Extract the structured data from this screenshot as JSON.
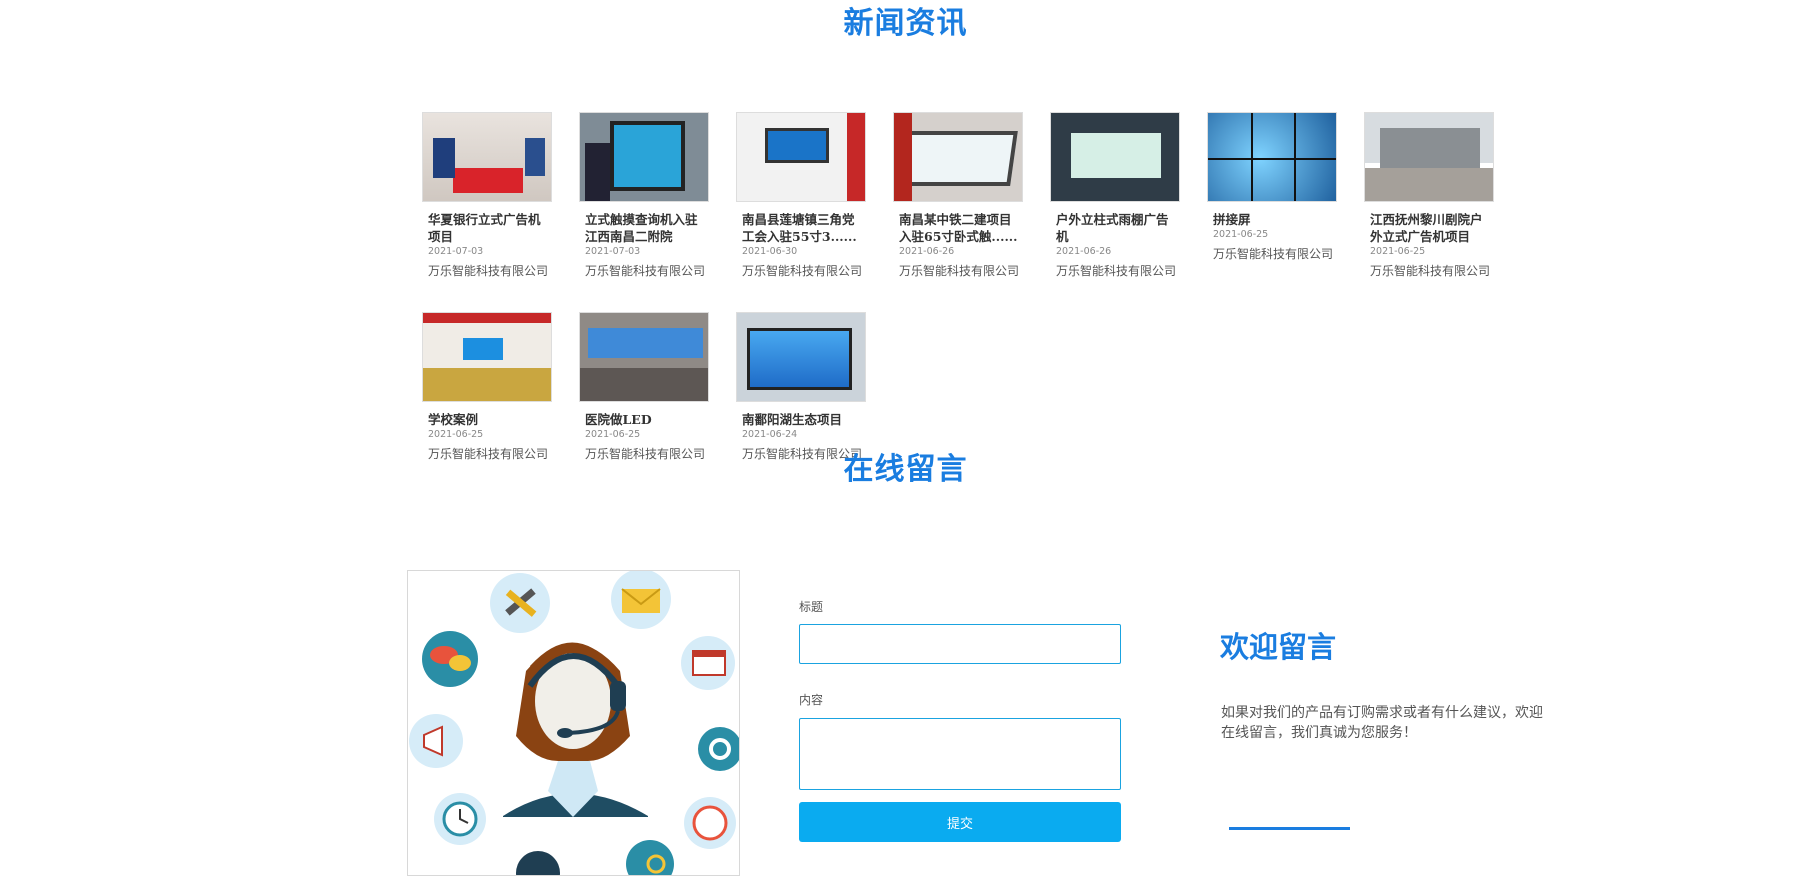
{
  "sections": {
    "news_title": "新闻资讯",
    "message_title": "在线留言"
  },
  "news": [
    {
      "title": "华夏银行立式广告机项目",
      "date": "2021-07-03",
      "source": "万乐智能科技有限公司",
      "image": "bank-lobby"
    },
    {
      "title": "立式触摸查询机入驻江西南昌二附院",
      "date": "2021-07-03",
      "source": "万乐智能科技有限公司",
      "image": "touch-kiosk"
    },
    {
      "title": "南昌县莲塘镇三角党工会入驻55寸3......",
      "date": "2021-06-30",
      "source": "万乐智能科技有限公司",
      "image": "display-wall"
    },
    {
      "title": "南昌某中铁二建项目入驻65寸卧式触......",
      "date": "2021-06-26",
      "source": "万乐智能科技有限公司",
      "image": "horizontal-kiosk"
    },
    {
      "title": "户外立柱式雨棚广告机",
      "date": "2021-06-26",
      "source": "万乐智能科技有限公司",
      "image": "outdoor-screen"
    },
    {
      "title": "拼接屏",
      "date": "2021-06-25",
      "source": "万乐智能科技有限公司",
      "image": "video-wall"
    },
    {
      "title": "江西抚州黎川剧院户外立式广告机项目",
      "date": "2021-06-25",
      "source": "万乐智能科技有限公司",
      "image": "theater"
    },
    {
      "title": "学校案例",
      "date": "2021-06-25",
      "source": "万乐智能科技有限公司",
      "image": "classroom"
    },
    {
      "title": "医院做LED",
      "date": "2021-06-25",
      "source": "万乐智能科技有限公司",
      "image": "hospital-led"
    },
    {
      "title": "南鄱阳湖生态项目",
      "date": "2021-06-24",
      "source": "万乐智能科技有限公司",
      "image": "splicing-screen"
    }
  ],
  "form": {
    "title_label": "标题",
    "title_value": "",
    "content_label": "内容",
    "content_value": "",
    "submit_label": "提交"
  },
  "welcome": {
    "title": "欢迎留言",
    "text": "如果对我们的产品有订购需求或者有什么建议，欢迎在线留言，我们真诚为您服务！"
  },
  "colors": {
    "accent": "#1a7de0",
    "button": "#0aabf0"
  },
  "illustration": {
    "icons": [
      "tools-icon",
      "mail-icon",
      "chat-icon",
      "calendar-icon",
      "megaphone-icon",
      "settings-icon",
      "clock-icon",
      "phone-icon",
      "gears-icon",
      "person-icon"
    ]
  }
}
